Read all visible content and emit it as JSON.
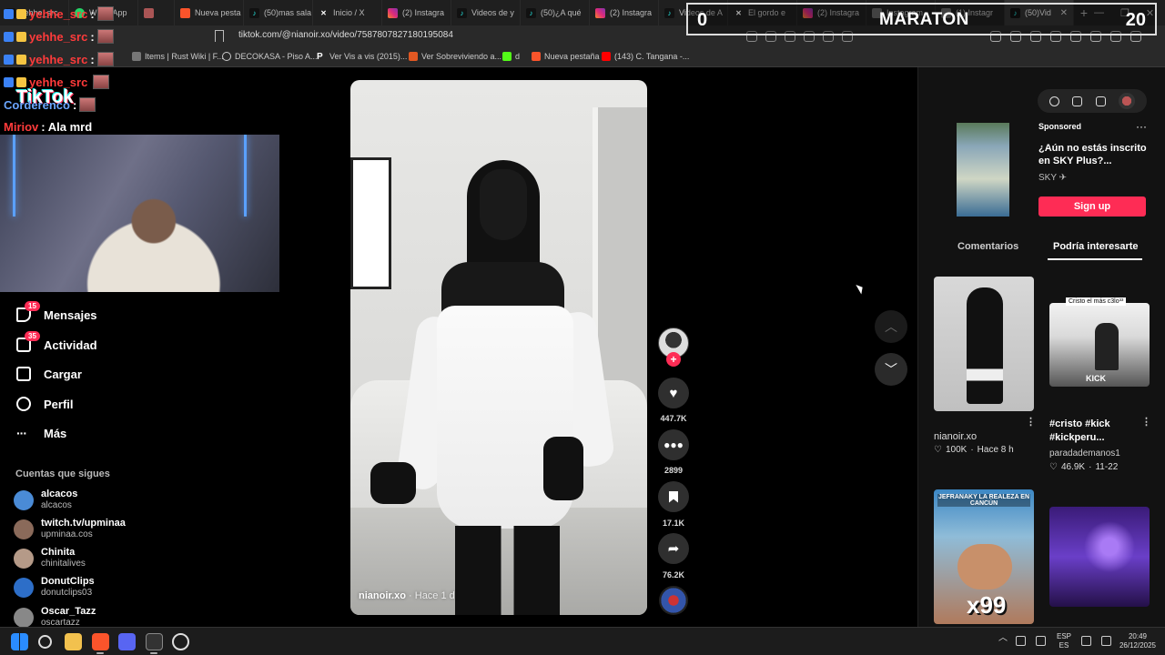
{
  "browser": {
    "tabs": [
      {
        "label": "yehhe_src",
        "icon": "tiktok-icon",
        "active": false
      },
      {
        "label": "WhatsApp",
        "icon": "whatsapp-icon",
        "active": false
      },
      {
        "label": "",
        "icon": "profile-icon",
        "active": false
      },
      {
        "label": "Nueva pesta",
        "icon": "brave-icon",
        "active": false
      },
      {
        "label": "(50)mas sala",
        "icon": "tiktok-icon",
        "active": false
      },
      {
        "label": "Inicio / X",
        "icon": "x-icon",
        "active": false
      },
      {
        "label": "(2) Instagra",
        "icon": "instagram-icon",
        "active": false
      },
      {
        "label": "Videos de y",
        "icon": "tiktok-icon",
        "active": false
      },
      {
        "label": "(50)¿A qué",
        "icon": "tiktok-icon",
        "active": false
      },
      {
        "label": "(2) Instagra",
        "icon": "instagram-icon",
        "active": false
      },
      {
        "label": "Videos de A",
        "icon": "tiktok-icon",
        "active": false
      },
      {
        "label": "El gordo e",
        "icon": "x-icon",
        "active": false
      },
      {
        "label": "(2) Instagra",
        "icon": "instagram-icon",
        "active": false
      },
      {
        "label": "Instagram",
        "icon": "instagram-icon",
        "active": false
      },
      {
        "label": "(1) Instagr",
        "icon": "instagram-icon",
        "active": false
      },
      {
        "label": "(50)Vid",
        "icon": "tiktok-icon",
        "active": true
      }
    ],
    "url": "tiktok.com/@nianoir.xo/video/7587807827180195084",
    "bookmarks": [
      {
        "label": "Items | Rust Wiki | F..."
      },
      {
        "label": "DECOKASA - Piso A..."
      },
      {
        "label": "Ver Vis a vis (2015)..."
      },
      {
        "label": "Ver Sobreviviendo a..."
      },
      {
        "label": "d"
      },
      {
        "label": "Nueva pestaña"
      },
      {
        "label": "(143) C. Tangana -..."
      }
    ]
  },
  "score": {
    "left": "0",
    "title": "MARATON",
    "right": "20"
  },
  "chat": [
    {
      "user": "yehhe_src",
      "msg": ":"
    },
    {
      "user": "yehhe_src",
      "msg": ":"
    },
    {
      "user": "yehhe_src",
      "msg": ":"
    },
    {
      "user": "yehhe_src",
      "msg": ""
    },
    {
      "user": "Corderenco",
      "msg": ":"
    },
    {
      "user": "Miriov",
      "msg": ": Ala mrd"
    }
  ],
  "logo": "TikTok",
  "sidebar": {
    "items": [
      {
        "label": "Mensajes",
        "badge": "15",
        "icon": "messages-icon"
      },
      {
        "label": "Actividad",
        "badge": "35",
        "icon": "activity-icon"
      },
      {
        "label": "Cargar",
        "badge": "",
        "icon": "upload-icon"
      },
      {
        "label": "Perfil",
        "badge": "",
        "icon": "profile-icon"
      },
      {
        "label": "Más",
        "badge": "",
        "icon": "more-icon"
      }
    ],
    "following_title": "Cuentas que sigues",
    "accounts": [
      {
        "name": "alcacos",
        "handle": "alcacos",
        "color": "#4a8bd6"
      },
      {
        "name": "twitch.tv/upminaa",
        "handle": "upminaa.cos",
        "color": "#8a6a5a"
      },
      {
        "name": "Chinita",
        "handle": "chinitalives",
        "color": "#b59a88"
      },
      {
        "name": "DonutClips",
        "handle": "donutclips03",
        "color": "#2d6ec8"
      },
      {
        "name": "Oscar_Tazz",
        "handle": "oscartazz",
        "color": "#888888"
      }
    ]
  },
  "video": {
    "author": "nianoir.xo",
    "time": " · Hace 1 d",
    "likes": "447.7K",
    "comments": "2899",
    "saves": "17.1K",
    "shares": "76.2K"
  },
  "right_panel": {
    "ad": {
      "sponsored": "Sponsored",
      "title": "¿Aún no estás inscrito en SKY Plus?...",
      "brand": "SKY ✈",
      "cta": "Sign up"
    },
    "tabs": {
      "comments": "Comentarios",
      "suggested": "Podría interesarte"
    },
    "cards": [
      {
        "title": "",
        "author": "nianoir.xo",
        "likes": "100K",
        "when": "Hace 8 h"
      },
      {
        "title": "#cristo #kick #kickperu...",
        "author": "paradademanos1",
        "likes": "46.9K",
        "when": "11-22",
        "caption": "Cristo el más c3lo³³"
      },
      {
        "title": "",
        "author": "",
        "likes": "",
        "when": "",
        "caption": "JEFRANAKY LA REALEZA EN CANCÚN",
        "badge": "x99"
      },
      {
        "title": "",
        "author": "",
        "likes": "",
        "when": ""
      }
    ]
  },
  "taskbar": {
    "lang": "ESP",
    "region": "ES",
    "time": "20:49",
    "date": "26/12/2025"
  },
  "colors": {
    "brand": "#fe2c55",
    "bg": "#000000",
    "panel": "#121212"
  }
}
